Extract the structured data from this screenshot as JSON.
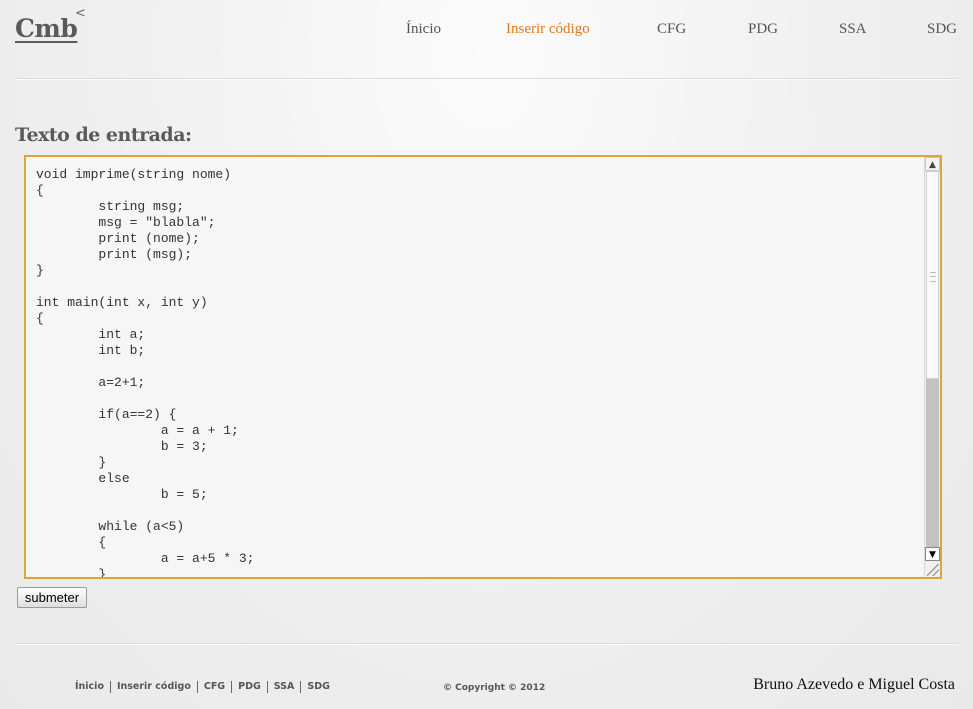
{
  "logo": {
    "text": "Cmb",
    "mark": "<"
  },
  "nav": {
    "items": [
      {
        "label": "Ínicio",
        "active": false
      },
      {
        "label": "Inserir código",
        "active": true
      },
      {
        "label": "CFG",
        "active": false
      },
      {
        "label": "PDG",
        "active": false
      },
      {
        "label": "SSA",
        "active": false
      },
      {
        "label": "SDG",
        "active": false
      }
    ],
    "active_color": "#e07b1a"
  },
  "main": {
    "heading": "Texto de entrada:",
    "code": "void imprime(string nome)\n{\n\tstring msg;\n\tmsg = \"blabla\";\n\tprint (nome);\n\tprint (msg);\n}\n\nint main(int x, int y)\n{\n\tint a;\n\tint b;\n\n\ta=2+1;\n\n\tif(a==2) {\n\t\ta = a + 1;\n\t\tb = 3;\n\t}\n\telse\n\t\tb = 5;\n\n\twhile (a<5)\n\t{\n\t\ta = a+5 * 3;\n\t}",
    "border_color": "#e0a23c",
    "submit_label": "submeter"
  },
  "footer": {
    "links": [
      "Ínicio",
      "Inserir código",
      "CFG",
      "PDG",
      "SSA",
      "SDG"
    ],
    "copyright": "© Copyright © 2012",
    "authors": "Bruno Azevedo e Miguel Costa"
  }
}
